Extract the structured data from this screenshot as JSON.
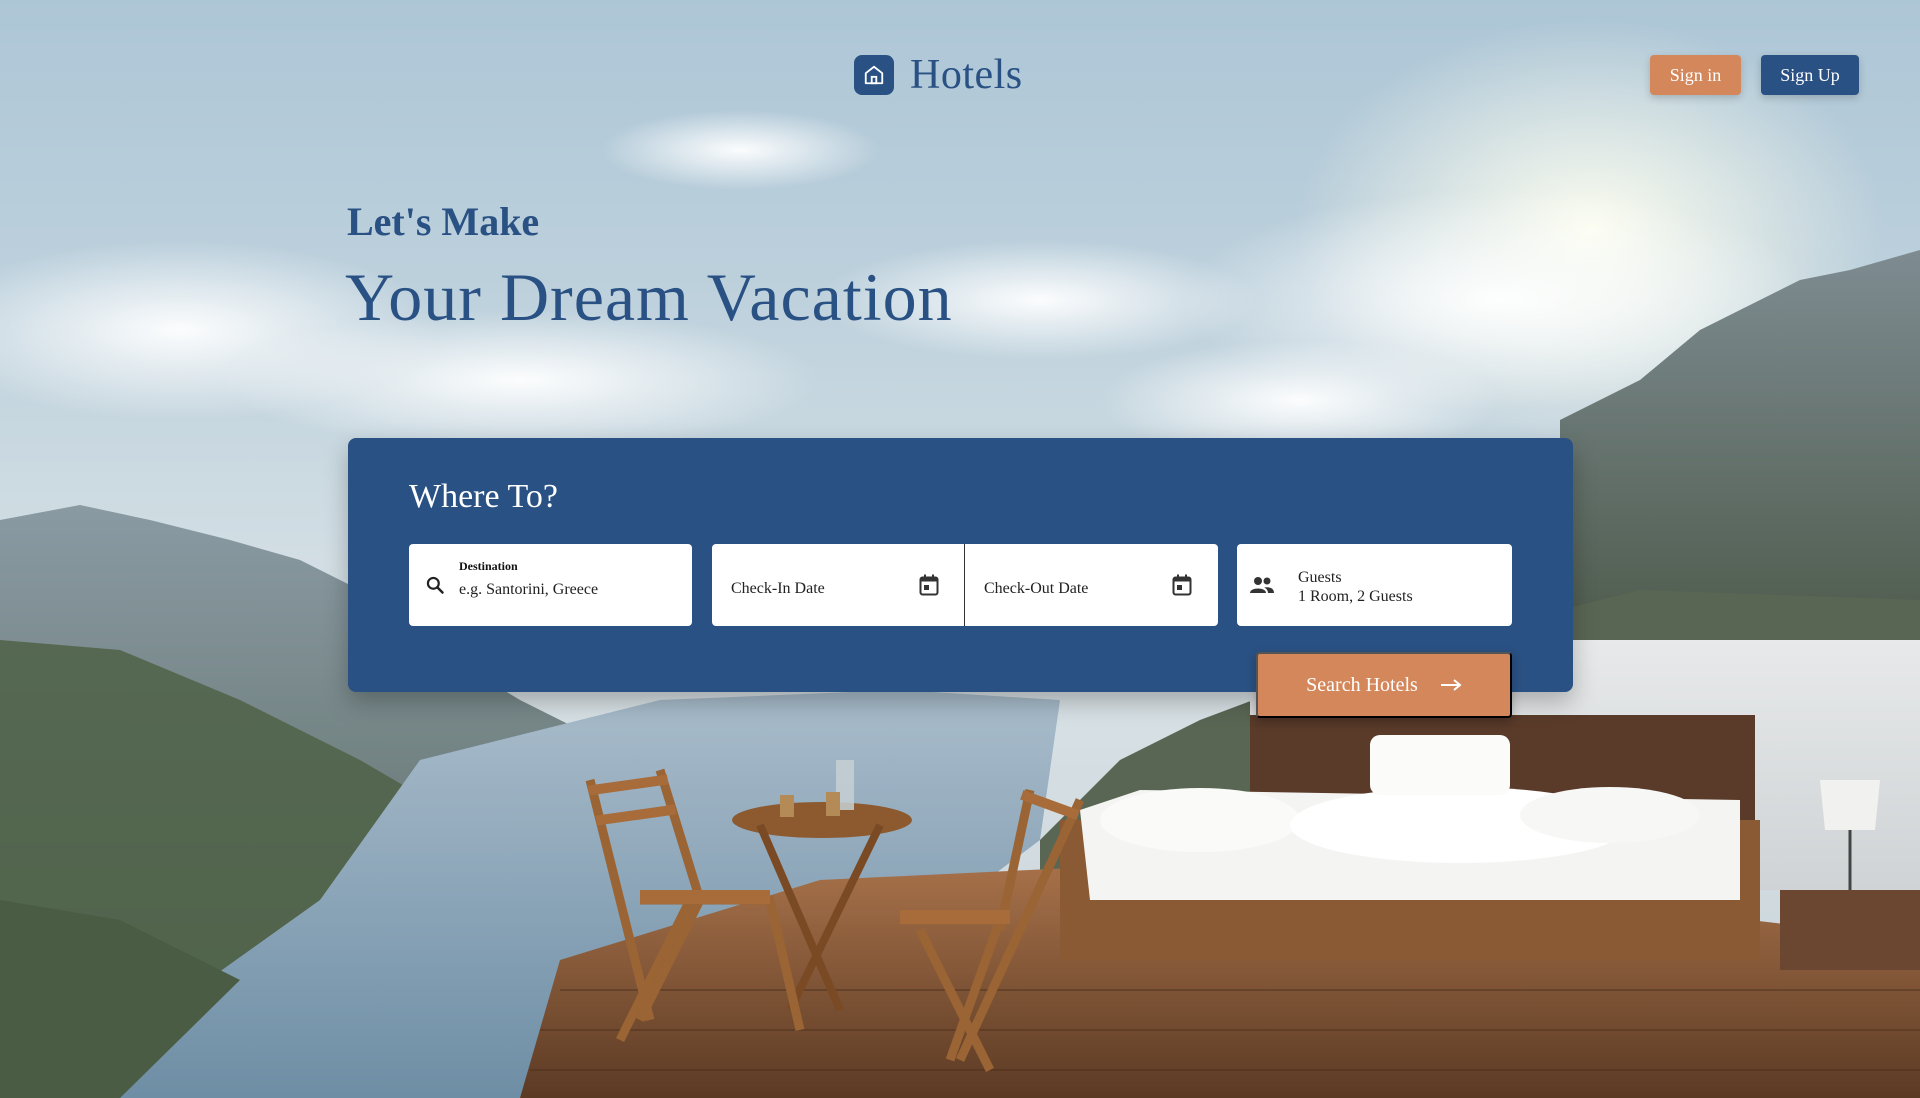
{
  "header": {
    "brand_name": "Hotels",
    "brand_icon": "home-icon",
    "sign_in_label": "Sign in",
    "sign_up_label": "Sign Up"
  },
  "hero": {
    "kicker": "Let's Make",
    "title": "Your Dream Vacation"
  },
  "search": {
    "title": "Where To?",
    "destination_label": "Destination",
    "destination_placeholder": "e.g. Santorini, Greece",
    "check_in": "Check-In Date",
    "check_out": "Check-Out Date",
    "guests_label": "Guests",
    "guests_value": "1 Room, 2 Guests",
    "submit_label": "Search Hotels",
    "icons": {
      "destination": "search-icon",
      "check_in": "calendar-icon",
      "check_out": "calendar-icon",
      "guests": "people-icon",
      "submit": "arrow-right-icon"
    }
  },
  "colors": {
    "primary": "#2a5183",
    "accent": "#d4875a",
    "field_bg": "#ffffff"
  }
}
